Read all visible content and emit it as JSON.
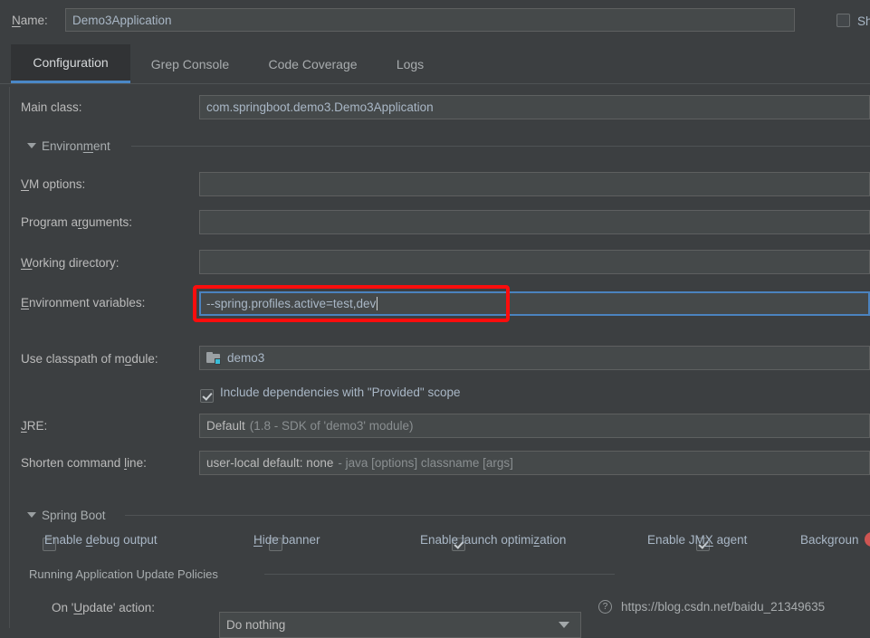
{
  "window": {
    "theme_bg": "#3c3f41",
    "accent": "#4a88c7",
    "annotation_color": "#fb0d0d"
  },
  "name_row": {
    "label": "Name:",
    "label_mnemonic": "N",
    "value": "Demo3Application",
    "share_checkbox": {
      "label": "Sh",
      "checked": false
    }
  },
  "tabs": [
    {
      "label": "Configuration",
      "active": true
    },
    {
      "label": "Grep Console",
      "active": false
    },
    {
      "label": "Code Coverage",
      "active": false
    },
    {
      "label": "Logs",
      "active": false
    }
  ],
  "main_class": {
    "label": "Main class:",
    "value": "com.springboot.demo3.Demo3Application"
  },
  "environment_section": {
    "title": "Environment",
    "title_mnemonic": "m",
    "rows": [
      {
        "label": "VM options:",
        "mnemonic": "V",
        "value": ""
      },
      {
        "label": "Program arguments:",
        "mnemonic": "r",
        "value": ""
      },
      {
        "label": "Working directory:",
        "mnemonic": "W",
        "value": ""
      }
    ],
    "env_variables": {
      "label": "Environment variables:",
      "mnemonic": "E",
      "value": "--spring.profiles.active=test,dev",
      "focused": true,
      "annotated": true
    },
    "classpath": {
      "label": "Use classpath of module:",
      "mnemonic": "o",
      "value": "demo3",
      "icon": "module-folder-icon"
    },
    "include_provided": {
      "label": "Include dependencies with \"Provided\" scope",
      "checked": true
    },
    "jre": {
      "label": "JRE:",
      "mnemonic": "J",
      "value": "Default",
      "value_detail": "(1.8 - SDK of 'demo3' module)"
    },
    "shorten_command_line": {
      "label": "Shorten command line:",
      "mnemonic": "l",
      "value": "user-local default: none",
      "value_detail": "- java [options] classname [args]"
    }
  },
  "spring_boot_section": {
    "title": "Spring Boot",
    "checkboxes": [
      {
        "label": "Enable debug output",
        "mnemonic": "d",
        "checked": false
      },
      {
        "label": "Hide banner",
        "mnemonic": "H",
        "checked": false
      },
      {
        "label": "Enable launch optimization",
        "mnemonic": "z",
        "checked": true
      },
      {
        "label": "Enable JMX agent",
        "mnemonic": "X",
        "checked": true
      }
    ],
    "background_item": {
      "icon": "error-icon",
      "label": "Backgroun"
    }
  },
  "update_policies_section": {
    "title": "Running Application Update Policies",
    "on_update_action": {
      "label": "On 'Update' action:",
      "mnemonic": "U",
      "value": "Do nothing"
    },
    "help_icon": "help-icon"
  },
  "watermark": {
    "text": "https://blog.csdn.net/baidu_21349635"
  }
}
